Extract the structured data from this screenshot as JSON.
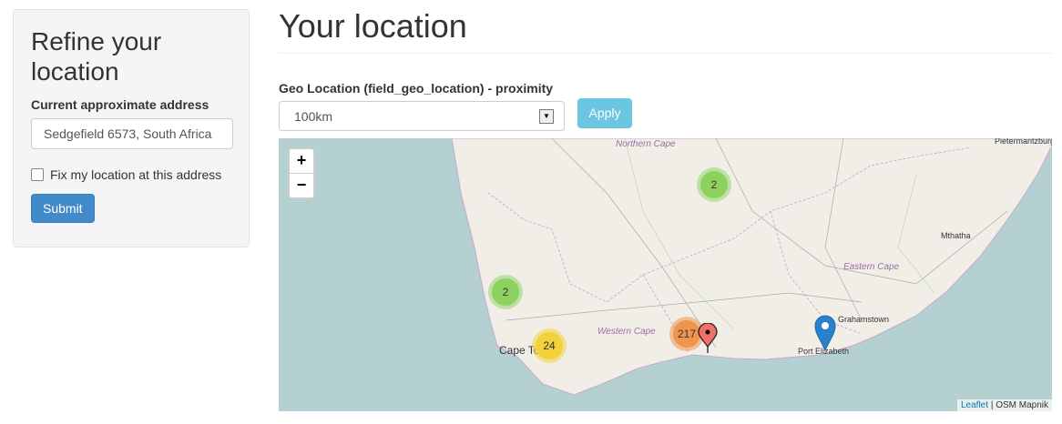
{
  "sidebar": {
    "heading": "Refine your location",
    "address_label": "Current approximate address",
    "address_value": "Sedgefield 6573, South Africa",
    "fix_label": "Fix my location at this address",
    "submit": "Submit"
  },
  "main": {
    "title": "Your location",
    "filter_label": "Geo Location (field_geo_location) - proximity",
    "proximity_value": "100km",
    "apply": "Apply"
  },
  "map": {
    "zoom_in": "+",
    "zoom_out": "−",
    "clusters": [
      {
        "count": "2"
      },
      {
        "count": "2"
      },
      {
        "count": "24"
      },
      {
        "count": "217"
      }
    ],
    "labels": {
      "northern_cape": "Northern Cape",
      "pietermaritzburg": "Pietermaritzburg",
      "mthatha": "Mthatha",
      "eastern_cape": "Eastern Cape",
      "western_cape": "Western Cape",
      "cape_town": "Cape Town",
      "grahamstown": "Grahamstown",
      "port_elizabeth": "Port Elizabeth"
    },
    "attribution_link": "Leaflet",
    "attribution_sep": "|",
    "attribution_text": "OSM Mapnik",
    "colors": {
      "sea": "#b5d0d0",
      "land": "#f1eee8",
      "small": "#8dd15f",
      "medium": "#f1d13c",
      "large": "#f0954f"
    }
  }
}
